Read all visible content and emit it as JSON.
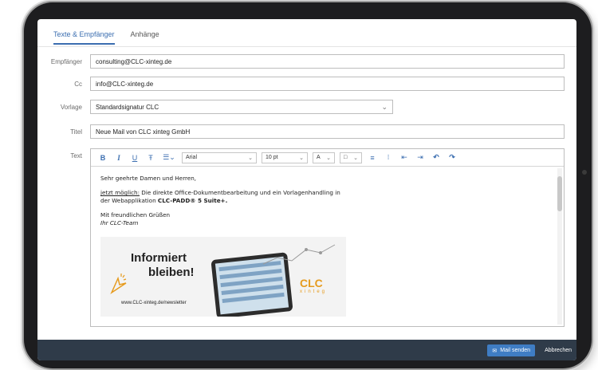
{
  "tabs": [
    "Texte & Empfänger",
    "Anhänge"
  ],
  "fields": {
    "recipient_label": "Empfänger",
    "recipient_value": "consulting@CLC-xinteg.de",
    "cc_label": "Cc",
    "cc_value": "info@CLC-xinteg.de",
    "template_label": "Vorlage",
    "template_value": "Standardsignatur CLC",
    "title_label": "Titel",
    "title_value": "Neue Mail von CLC xinteg GmbH",
    "text_label": "Text"
  },
  "toolbar": {
    "font": "Arial",
    "size": "10 pt"
  },
  "content": {
    "greeting": "Sehr geehrte Damen und Herren,",
    "line1_underline": "jetzt möglich:",
    "line1_rest": " Die direkte Office-Dokumentbearbeitung und ein Vorlagenhandling in",
    "line2_pre": "der Webapplikation ",
    "line2_bold": "CLC-PADD® 5 Suite+.",
    "closing": "Mit freundlichen Grüßen",
    "signature": "Ihr CLC-Team"
  },
  "banner": {
    "line1": "Informiert",
    "line2": "bleiben!",
    "url": "www.CLC-xinteg.de/newsletter",
    "logo_top": "CLC",
    "logo_bottom": "xinteg"
  },
  "footer": {
    "send": "Mail senden",
    "cancel": "Abbrechen"
  },
  "colors": {
    "accent": "#3b6eb0",
    "footer_bg": "#2f3b49",
    "send_bg": "#3f7dc4"
  }
}
